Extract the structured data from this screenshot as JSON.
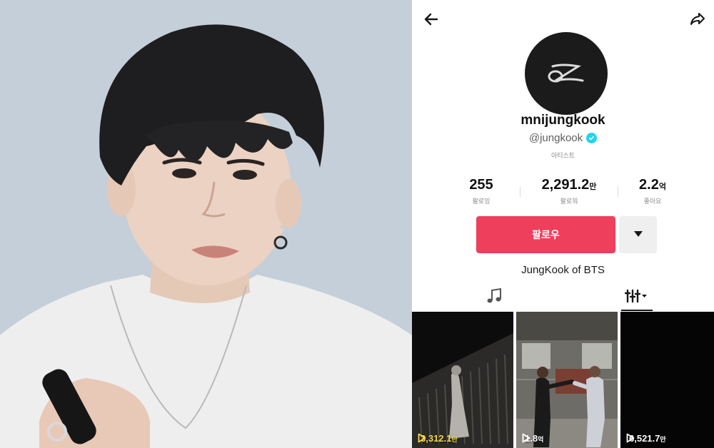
{
  "profile": {
    "display_name": "mnijungkook",
    "handle": "@jungkook",
    "category": "아티스트",
    "stats": [
      {
        "value": "255",
        "unit": "",
        "label": "팔로잉"
      },
      {
        "value": "2,291.2",
        "unit": "만",
        "label": "팔로워"
      },
      {
        "value": "2.2",
        "unit": "억",
        "label": "좋아요"
      }
    ],
    "follow_label": "팔로우",
    "bio": "JungKook of BTS"
  },
  "icons": {
    "back": "arrow-left-icon",
    "share": "share-arrow-icon",
    "verified": "verified-check-icon",
    "more": "caret-down-icon",
    "music_tab": "music-note-icon",
    "grid_tab": "sort-bars-icon",
    "play": "play-outline-icon"
  },
  "videos": [
    {
      "views": "3,312.1",
      "unit": "만"
    },
    {
      "views": "1.8",
      "unit": "억"
    },
    {
      "views": "6,521.7",
      "unit": "만"
    }
  ],
  "colors": {
    "follow": "#ee3f5c",
    "views_text_first": "#f5d94c",
    "verified": "#20d5ec"
  }
}
